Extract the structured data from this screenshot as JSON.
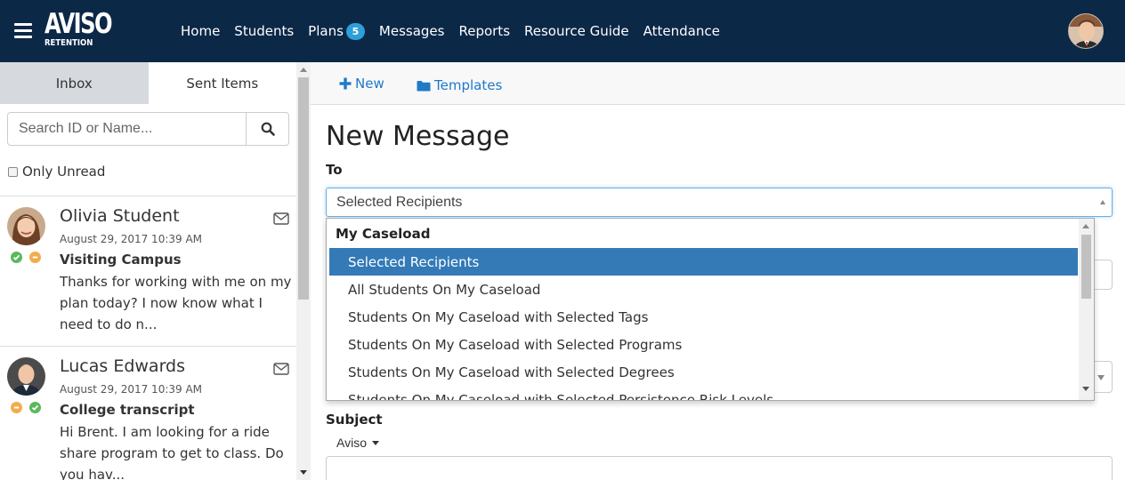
{
  "navbar": {
    "logo_line1": "AVISO",
    "logo_line2": "RETENTION",
    "links": [
      {
        "label": "Home"
      },
      {
        "label": "Students"
      },
      {
        "label": "Plans",
        "badge": "5"
      },
      {
        "label": "Messages"
      },
      {
        "label": "Reports"
      },
      {
        "label": "Resource Guide"
      },
      {
        "label": "Attendance"
      }
    ]
  },
  "sidebar": {
    "tabs": [
      {
        "label": "Inbox"
      },
      {
        "label": "Sent Items"
      }
    ],
    "search_placeholder": "Search ID or Name...",
    "only_unread_label": "Only Unread",
    "messages": [
      {
        "name": "Olivia Student",
        "date": "August 29, 2017 10:39 AM",
        "subject": "Visiting Campus",
        "preview": "Thanks for working with me on my plan today? I now know what I need to do n..."
      },
      {
        "name": "Lucas Edwards",
        "date": "August 29, 2017 10:39 AM",
        "subject": "College transcript",
        "preview": "Hi Brent. I am looking for a ride share program to get to class. Do you hav..."
      }
    ]
  },
  "toolbar": {
    "new_label": "New",
    "templates_label": "Templates"
  },
  "compose": {
    "title": "New Message",
    "to_label": "To",
    "to_value": "Selected Recipients",
    "dropdown": {
      "group": "My Caseload",
      "items": [
        "Selected Recipients",
        "All Students On My Caseload",
        "Students On My Caseload with Selected Tags",
        "Students On My Caseload with Selected Programs",
        "Students On My Caseload with Selected Degrees",
        "Students On My Caseload with Selected Persistence Risk Levels"
      ],
      "selected_index": 0
    },
    "subject_label": "Subject",
    "from_value": "Aviso"
  },
  "colors": {
    "navbar": "#0b2847",
    "accent": "#2079c7",
    "selected": "#337ab7",
    "badge": "#2e9fd8",
    "status_green": "#5cb85c",
    "status_orange": "#f0ad4e"
  }
}
